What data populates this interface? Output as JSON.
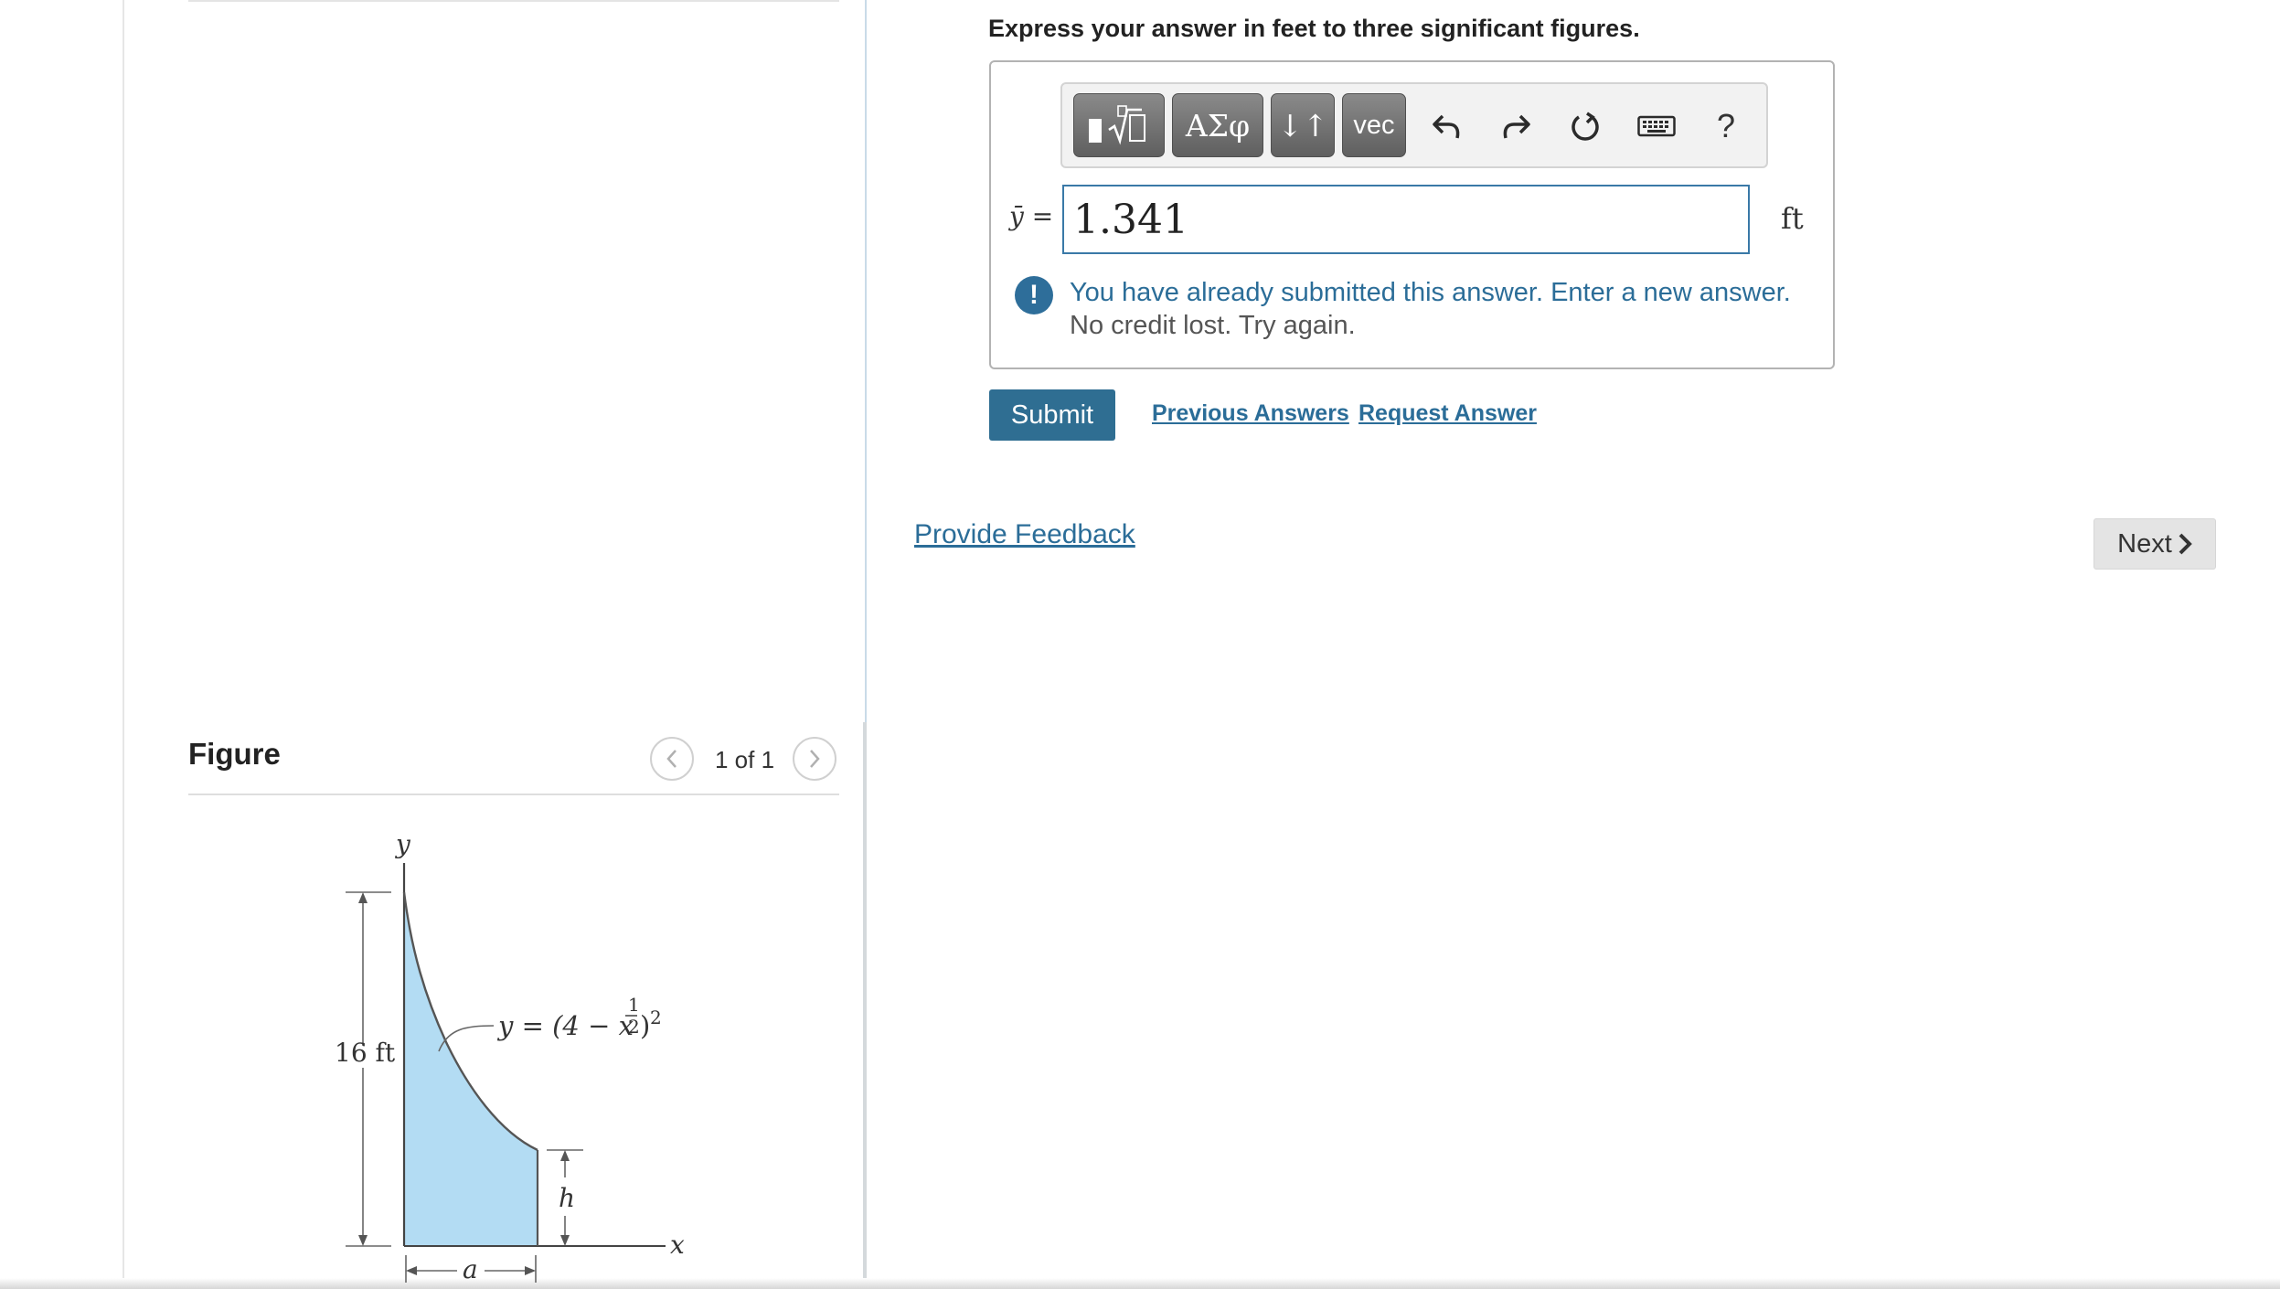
{
  "question": {
    "instructions": "Express your answer in feet to three significant figures."
  },
  "toolbar": {
    "templates_icon": "fraction-root-template-icon",
    "greek_label": "ΑΣφ",
    "arrows_label": "↓↑",
    "vec_label": "vec",
    "undo_icon": "undo-icon",
    "redo_icon": "redo-icon",
    "reset_icon": "reset-icon",
    "keyboard_icon": "keyboard-icon",
    "help_label": "?"
  },
  "answer": {
    "variable_symbol": "ȳ",
    "equals": "=",
    "value": "1.341",
    "unit": "ft"
  },
  "alert": {
    "icon_glyph": "!",
    "message": "You have already submitted this answer. Enter a new answer.",
    "detail": "No credit lost. Try again."
  },
  "actions": {
    "submit_label": "Submit",
    "previous_answers_label": "Previous Answers",
    "request_answer_label": "Request Answer",
    "provide_feedback_label": "Provide Feedback",
    "next_label": "Next"
  },
  "figure": {
    "title": "Figure",
    "pager": "1 of 1",
    "axis_y": "y",
    "axis_x": "x",
    "height_label": "16 ft",
    "curve_eq_lhs": "y = (4 − x",
    "curve_eq_exp_num": "1",
    "curve_eq_exp_den": "2",
    "curve_eq_rhs": ")",
    "curve_eq_outer_exp": "2",
    "h_label": "h",
    "a_label": "a",
    "accent_color": "#b3dcf3"
  }
}
